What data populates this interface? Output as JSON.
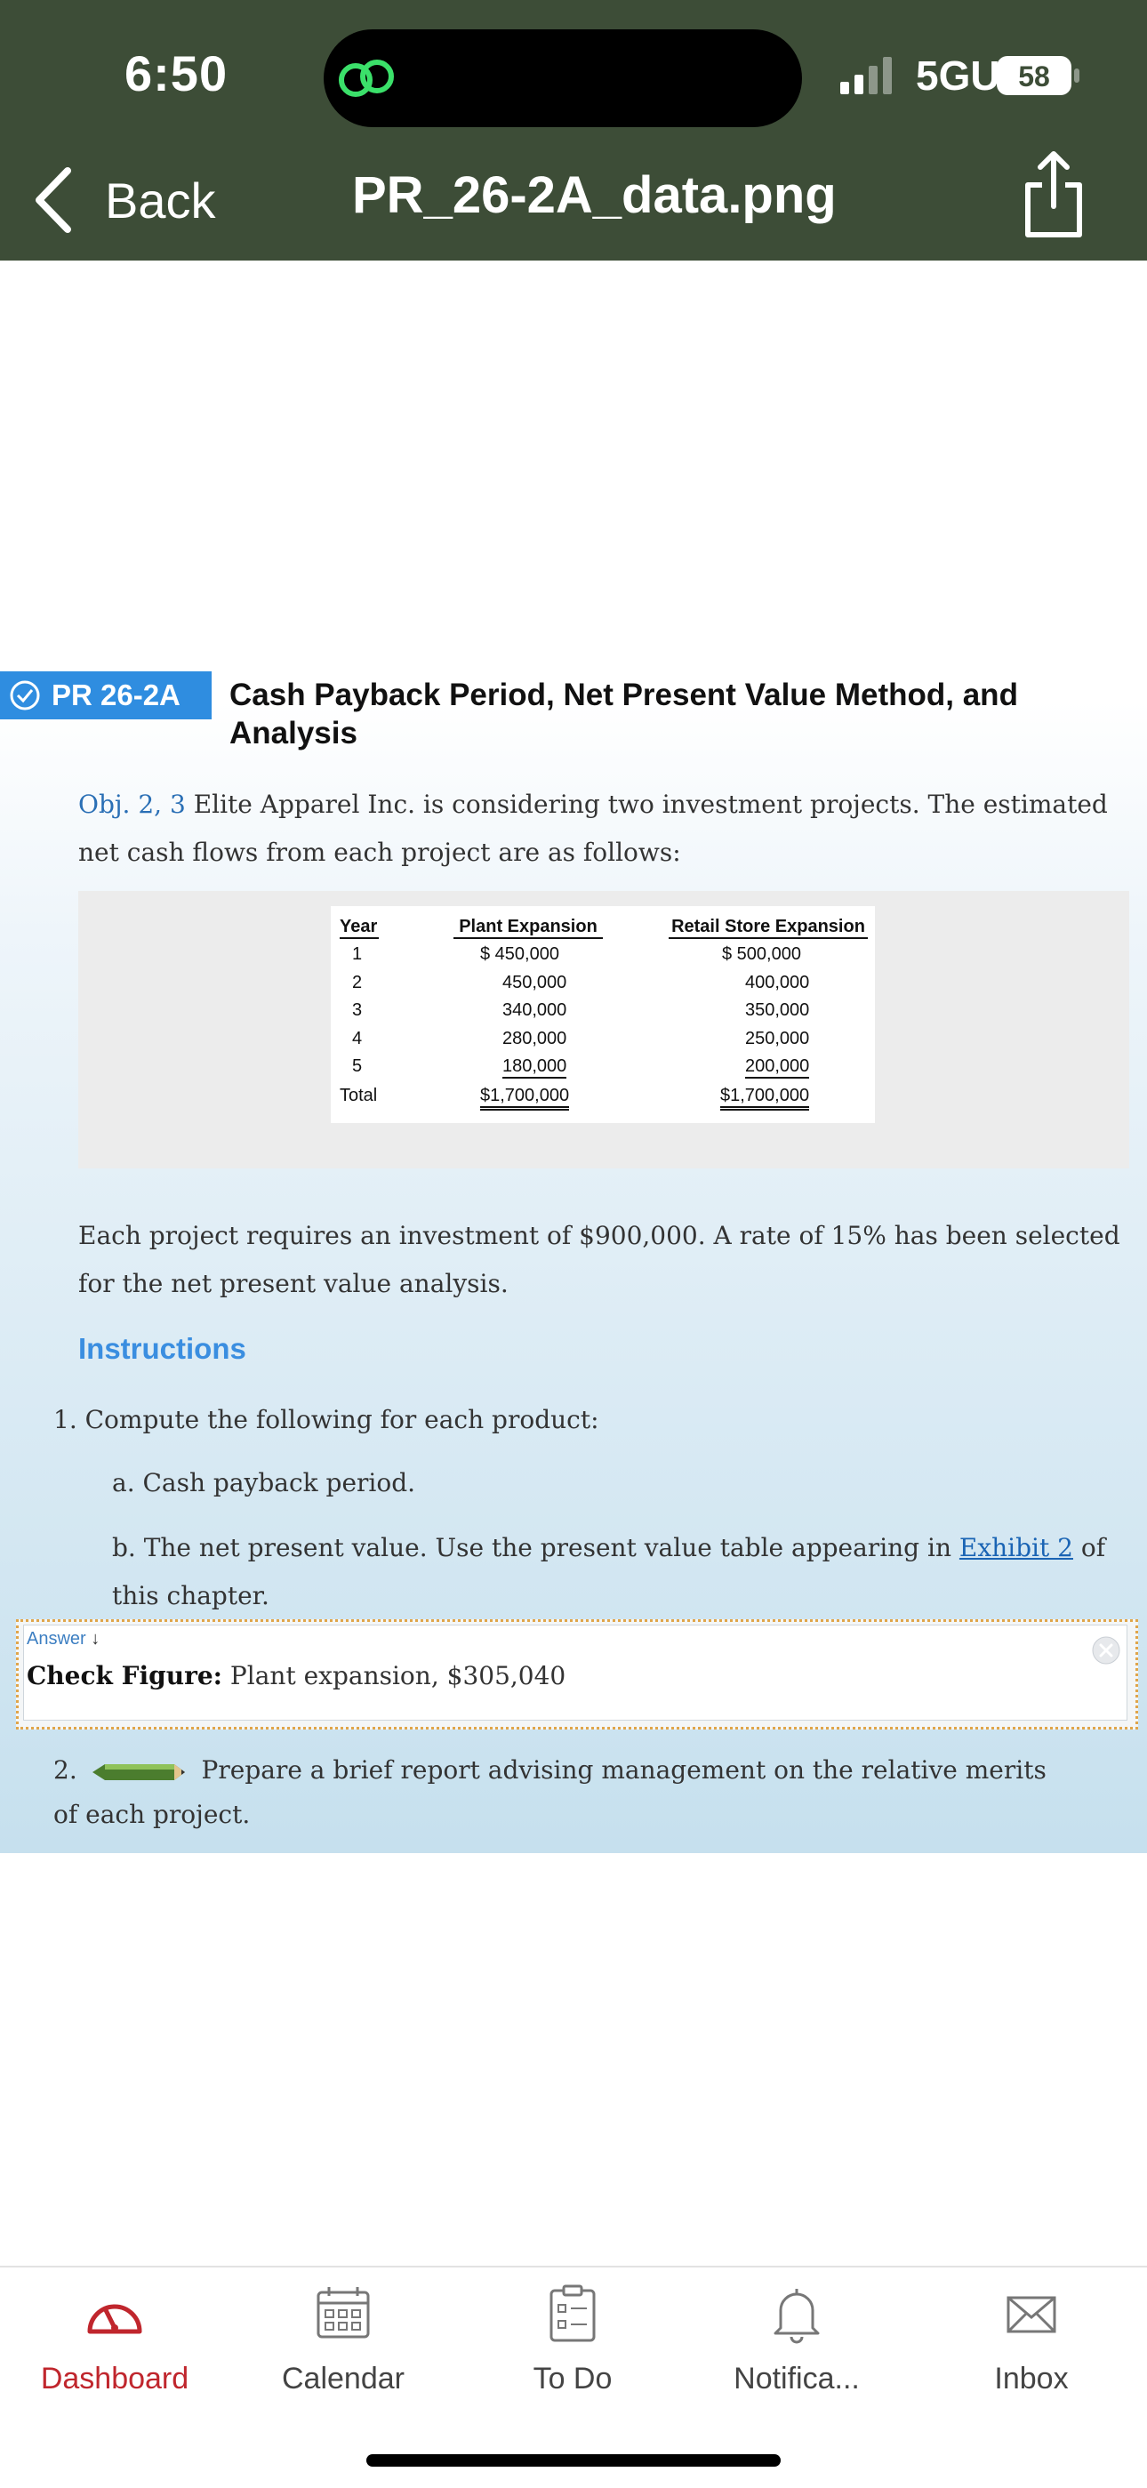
{
  "status_bar": {
    "time": "6:50",
    "network": "5GUC",
    "battery": "58"
  },
  "nav": {
    "back_label": "Back",
    "title": "PR_26-2A_data.png"
  },
  "problem": {
    "badge": "PR 26-2A",
    "title": "Cash Payback Period, Net Present Value Method, and Analysis",
    "obj_label": "Obj. 2, 3",
    "intro": "Elite Apparel Inc. is considering two investment projects. The estimated net cash flows from each project are as follows:",
    "table": {
      "headers": [
        "Year",
        "Plant Expansion",
        "Retail Store Expansion"
      ],
      "rows": [
        [
          "1",
          "$ 450,000",
          "$ 500,000"
        ],
        [
          "2",
          "450,000",
          "400,000"
        ],
        [
          "3",
          "340,000",
          "350,000"
        ],
        [
          "4",
          "280,000",
          "250,000"
        ],
        [
          "5",
          "180,000",
          "200,000"
        ],
        [
          "Total",
          "$1,700,000",
          "$1,700,000"
        ]
      ]
    },
    "paragraph": "Each project requires an investment of $900,000. A rate of 15% has been selected for the net present value analysis.",
    "instructions_heading": "Instructions",
    "step1": "1. Compute the following for each product:",
    "step1a": "a. Cash payback period.",
    "step1b_pre": "b. The net present value. Use the present value table appearing in",
    "step1b_link": "Exhibit 2",
    "step1b_post": "of this chapter.",
    "answer": {
      "label": "Answer",
      "arrow": "↓",
      "check_label": "Check Figure:",
      "check_value": "Plant expansion, $305,040"
    },
    "step2_num": "2.",
    "step2_text": "Prepare a brief report advising management on the relative merits of each project."
  },
  "tabbar": {
    "items": [
      {
        "label": "Dashboard",
        "icon": "dashboard-icon",
        "active": true
      },
      {
        "label": "Calendar",
        "icon": "calendar-icon",
        "active": false
      },
      {
        "label": "To Do",
        "icon": "todo-icon",
        "active": false
      },
      {
        "label": "Notifica...",
        "icon": "bell-icon",
        "active": false
      },
      {
        "label": "Inbox",
        "icon": "inbox-icon",
        "active": false
      }
    ]
  },
  "colors": {
    "header_bg": "#3d4d37",
    "badge_bg": "#2f8de0",
    "active_tab": "#c0262d",
    "link": "#1a64b4"
  }
}
